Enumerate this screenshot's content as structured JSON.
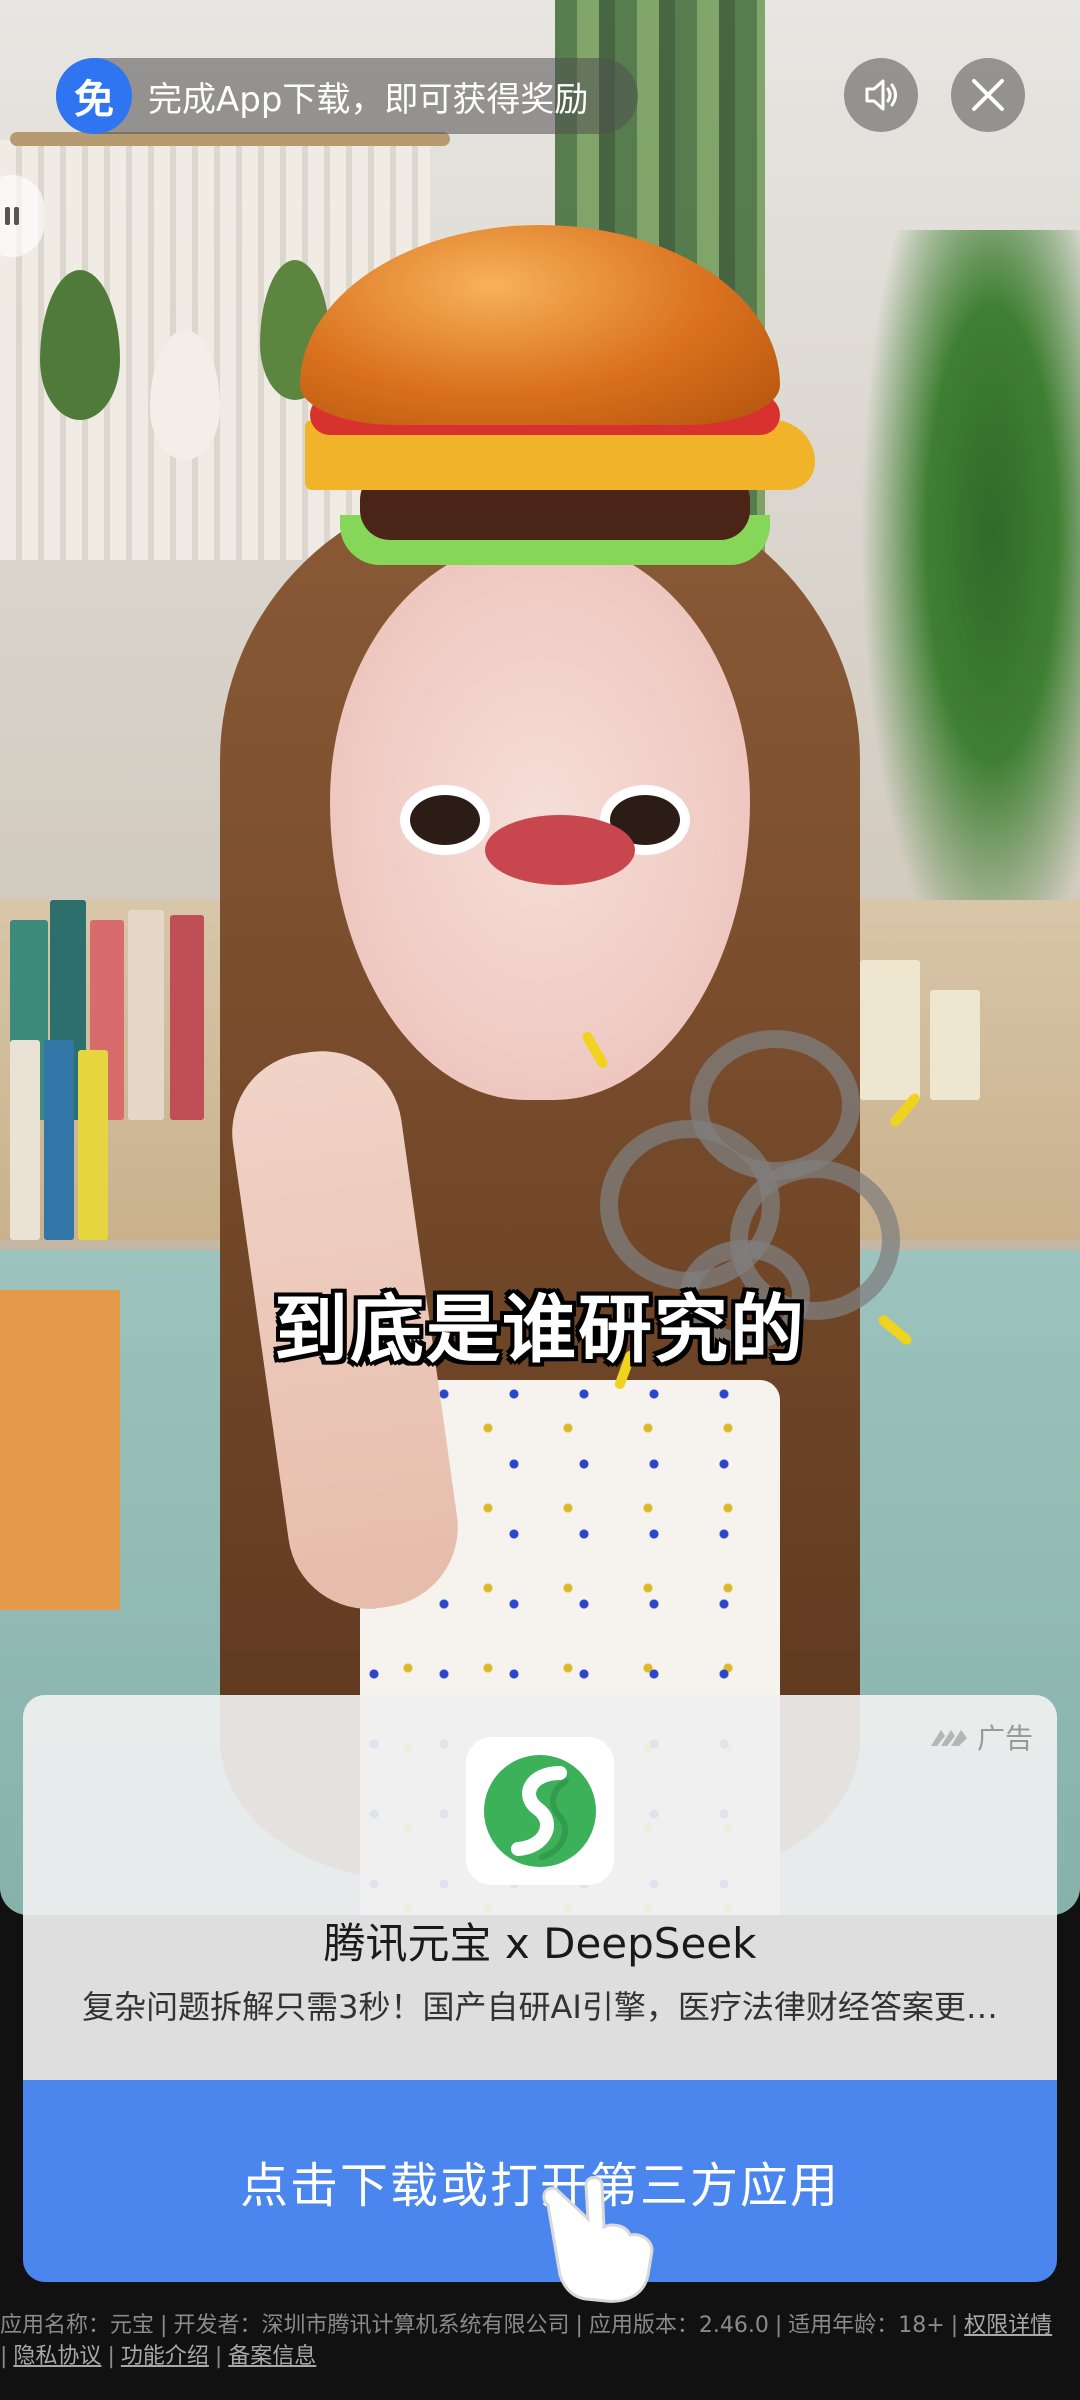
{
  "reward": {
    "badge": "免",
    "text": "完成App下载，即可获得奖励"
  },
  "controls": {
    "sound_icon": "speaker-icon",
    "close_icon": "close-icon"
  },
  "video": {
    "subtitle": "到底是谁研究的"
  },
  "ad": {
    "tag": "广告",
    "app_name": "腾讯元宝 x DeepSeek",
    "description": "复杂问题拆解只需3秒！国产自研AI引擎，医疗法律财经答案更…",
    "cta": "点击下载或打开第三方应用"
  },
  "footer": {
    "app_label": "应用名称：元宝",
    "developer": "开发者：深圳市腾讯计算机系统有限公司",
    "version": "应用版本：2.46.0",
    "age": "适用年龄：18+",
    "permissions": "权限详情",
    "privacy": "隐私协议",
    "features": "功能介绍",
    "filing": "备案信息"
  },
  "colors": {
    "accent": "#4a86ee",
    "badge": "#2f74f0"
  }
}
